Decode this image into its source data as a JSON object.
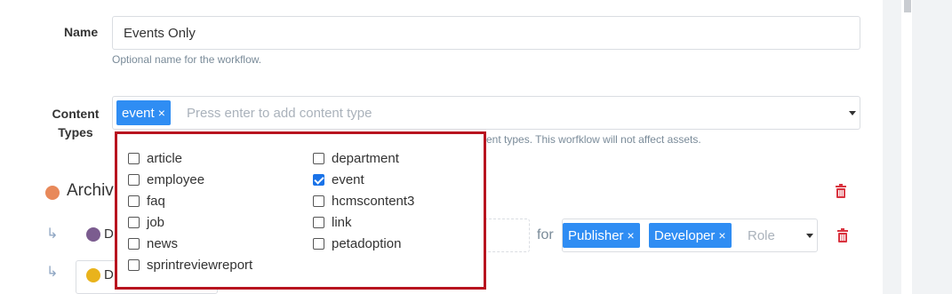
{
  "form": {
    "name_label": "Name",
    "name_value": "Events Only",
    "name_hint": "Optional name for the workflow.",
    "content_types_label_line1": "Content",
    "content_types_label_line2": "Types",
    "content_types_placeholder": "Press enter to add content type",
    "content_types_hint_visible": "ent types. This worfklow will not affect assets.",
    "selected_tags": [
      {
        "label": "event",
        "remove": "×"
      }
    ]
  },
  "stages": {
    "archive_label": "Archiv",
    "row1_prefix": "D",
    "row2_prefix": "D",
    "for_label": "for",
    "role_tags": [
      {
        "label": "Publisher",
        "remove": "×"
      },
      {
        "label": "Developer",
        "remove": "×"
      }
    ],
    "role_placeholder": "Role"
  },
  "dropdown": {
    "options": [
      {
        "label": "article",
        "checked": false
      },
      {
        "label": "department",
        "checked": false
      },
      {
        "label": "employee",
        "checked": false
      },
      {
        "label": "event",
        "checked": true
      },
      {
        "label": "faq",
        "checked": false
      },
      {
        "label": "hcmscontent3",
        "checked": false
      },
      {
        "label": "job",
        "checked": false
      },
      {
        "label": "link",
        "checked": false
      },
      {
        "label": "news",
        "checked": false
      },
      {
        "label": "petadoption",
        "checked": false
      },
      {
        "label": "sprintreviewreport",
        "checked": false
      }
    ]
  },
  "colors": {
    "tag_blue": "#2f8df3",
    "highlight_red": "#b8141f",
    "archive_dot": "#e8895a",
    "stage_dot_purple": "#7b5c8f",
    "stage_dot_yellow": "#e9b31c",
    "trash_red": "#d9333f"
  },
  "icons": {
    "remove": "close-icon",
    "trash": "trash-icon",
    "sub_arrow": "return-arrow-icon",
    "caret": "caret-down-icon"
  }
}
